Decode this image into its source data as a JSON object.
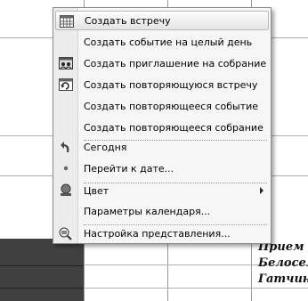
{
  "menu": {
    "items": [
      {
        "label": "Создать встречу",
        "icon": "calendar-grid-icon",
        "highlighted": true
      },
      {
        "label": "Создать событие на целый день",
        "icon": null
      },
      {
        "label": "Создать приглашение на собрание",
        "icon": "meeting-invite-icon"
      },
      {
        "label": "Создать повторяющуюся встречу",
        "icon": "recurring-appointment-icon"
      },
      {
        "label": "Создать повторяющееся событие",
        "icon": null
      },
      {
        "label": "Создать повторяющееся собрание",
        "icon": null
      },
      {
        "label": "Сегодня",
        "icon": "today-arrow-icon"
      },
      {
        "label": "Перейти к дате...",
        "icon": "bullet-dot-icon"
      },
      {
        "label": "Цвет",
        "icon": "color-icon",
        "submenu": true
      },
      {
        "label": "Параметры календаря...",
        "icon": null
      },
      {
        "label": "Настройка представления...",
        "icon": "customize-view-icon"
      }
    ]
  },
  "calendar": {
    "event_lines": [
      "Прием у",
      "Белосел",
      "Гатчина"
    ]
  }
}
